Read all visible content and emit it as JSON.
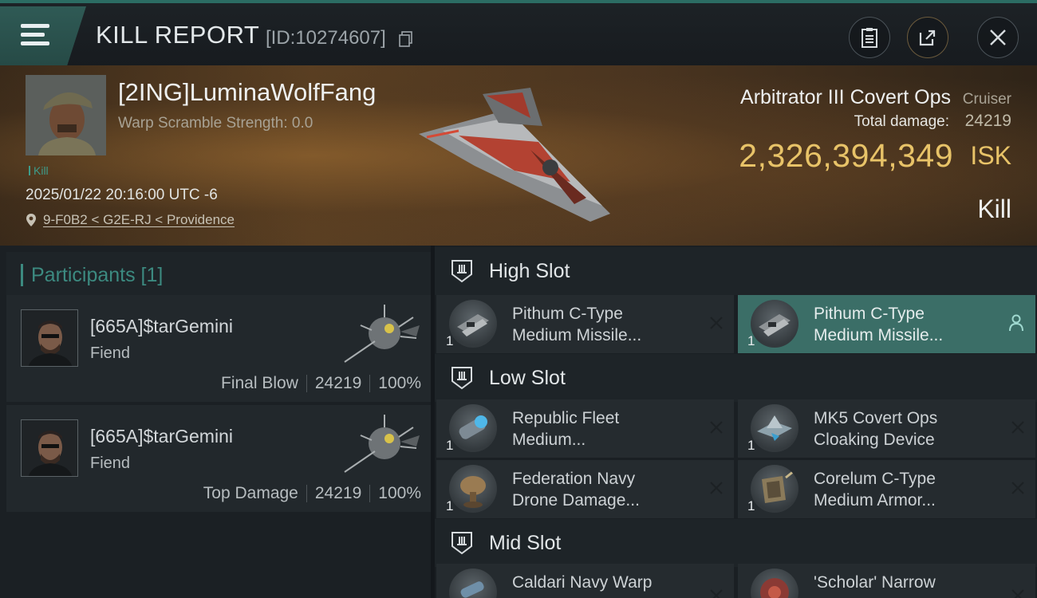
{
  "header": {
    "title": "KILL REPORT",
    "report_id": "[ID:10274607]"
  },
  "victim": {
    "name": "[2ING]LuminaWolfFang",
    "warp_scramble": "Warp Scramble Strength: 0.0",
    "tag": "Kill",
    "datetime": "2025/01/22 20:16:00 UTC -6",
    "location": "9-F0B2 < G2E-RJ < Providence",
    "ship_name": "Arbitrator III Covert Ops",
    "ship_class": "Cruiser",
    "total_damage_label": "Total damage:",
    "total_damage": "24219",
    "isk_value": "2,326,394,349",
    "isk_unit": "ISK",
    "result": "Kill"
  },
  "participants": {
    "header": "Participants [1]",
    "rows": [
      {
        "name": "[665A]$tarGemini",
        "ship": "Fiend",
        "role": "Final Blow",
        "damage": "24219",
        "percent": "100%"
      },
      {
        "name": "[665A]$tarGemini",
        "ship": "Fiend",
        "role": "Top Damage",
        "damage": "24219",
        "percent": "100%"
      }
    ]
  },
  "slots": {
    "high": {
      "label": "High Slot",
      "modules": [
        {
          "line1": "Pithum C-Type",
          "line2": "Medium Missile...",
          "qty": "1",
          "state": "destroyed",
          "icon": "missile-launcher-icon"
        },
        {
          "line1": "Pithum C-Type",
          "line2": "Medium Missile...",
          "qty": "1",
          "state": "dropped",
          "icon": "missile-launcher-icon"
        }
      ]
    },
    "low": {
      "label": "Low Slot",
      "modules": [
        {
          "line1": "Republic Fleet",
          "line2": "Medium...",
          "qty": "1",
          "state": "destroyed",
          "icon": "shield-booster-icon"
        },
        {
          "line1": "MK5 Covert Ops",
          "line2": "Cloaking Device",
          "qty": "1",
          "state": "destroyed",
          "icon": "cloaking-device-icon"
        },
        {
          "line1": "Federation Navy",
          "line2": "Drone Damage...",
          "qty": "1",
          "state": "destroyed",
          "icon": "drone-damage-icon"
        },
        {
          "line1": "Corelum C-Type",
          "line2": "Medium Armor...",
          "qty": "1",
          "state": "destroyed",
          "icon": "armor-repairer-icon"
        }
      ]
    },
    "mid": {
      "label": "Mid Slot",
      "modules": [
        {
          "line1": "Caldari Navy Warp",
          "line2": "",
          "qty": "1",
          "state": "destroyed",
          "icon": "warp-disruptor-icon"
        },
        {
          "line1": "'Scholar' Narrow",
          "line2": "",
          "qty": "1",
          "state": "destroyed",
          "icon": "scanner-icon"
        }
      ]
    }
  },
  "colors": {
    "accent_teal": "#3c8a80",
    "isk_gold": "#e8c368",
    "highlight_row": "#3b6e67"
  }
}
